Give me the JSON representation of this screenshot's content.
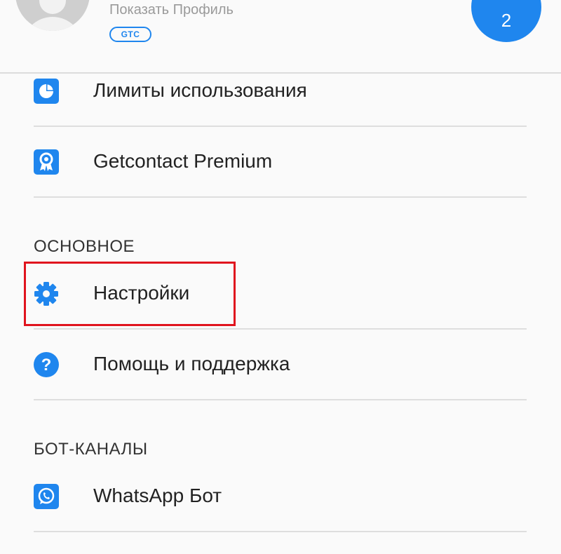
{
  "header": {
    "profile_link": "Показать Профиль",
    "gtc_badge": "GTC",
    "count": "2",
    "accent_color": "#1f86ee"
  },
  "menu": {
    "usage_limits": {
      "label": "Лимиты использования",
      "icon": "pie-chart-icon"
    },
    "premium": {
      "label": "Getcontact Premium",
      "icon": "award-badge-icon"
    }
  },
  "section_main": {
    "title": "ОСНОВНОЕ",
    "settings": {
      "label": "Настройки",
      "icon": "gear-icon"
    },
    "help": {
      "label": "Помощь и поддержка",
      "icon": "question-icon"
    }
  },
  "section_bots": {
    "title": "БОТ-КАНАЛЫ",
    "whatsapp": {
      "label": "WhatsApp Бот",
      "icon": "whatsapp-icon"
    }
  },
  "annotation": {
    "highlight_color": "#e0141e"
  }
}
